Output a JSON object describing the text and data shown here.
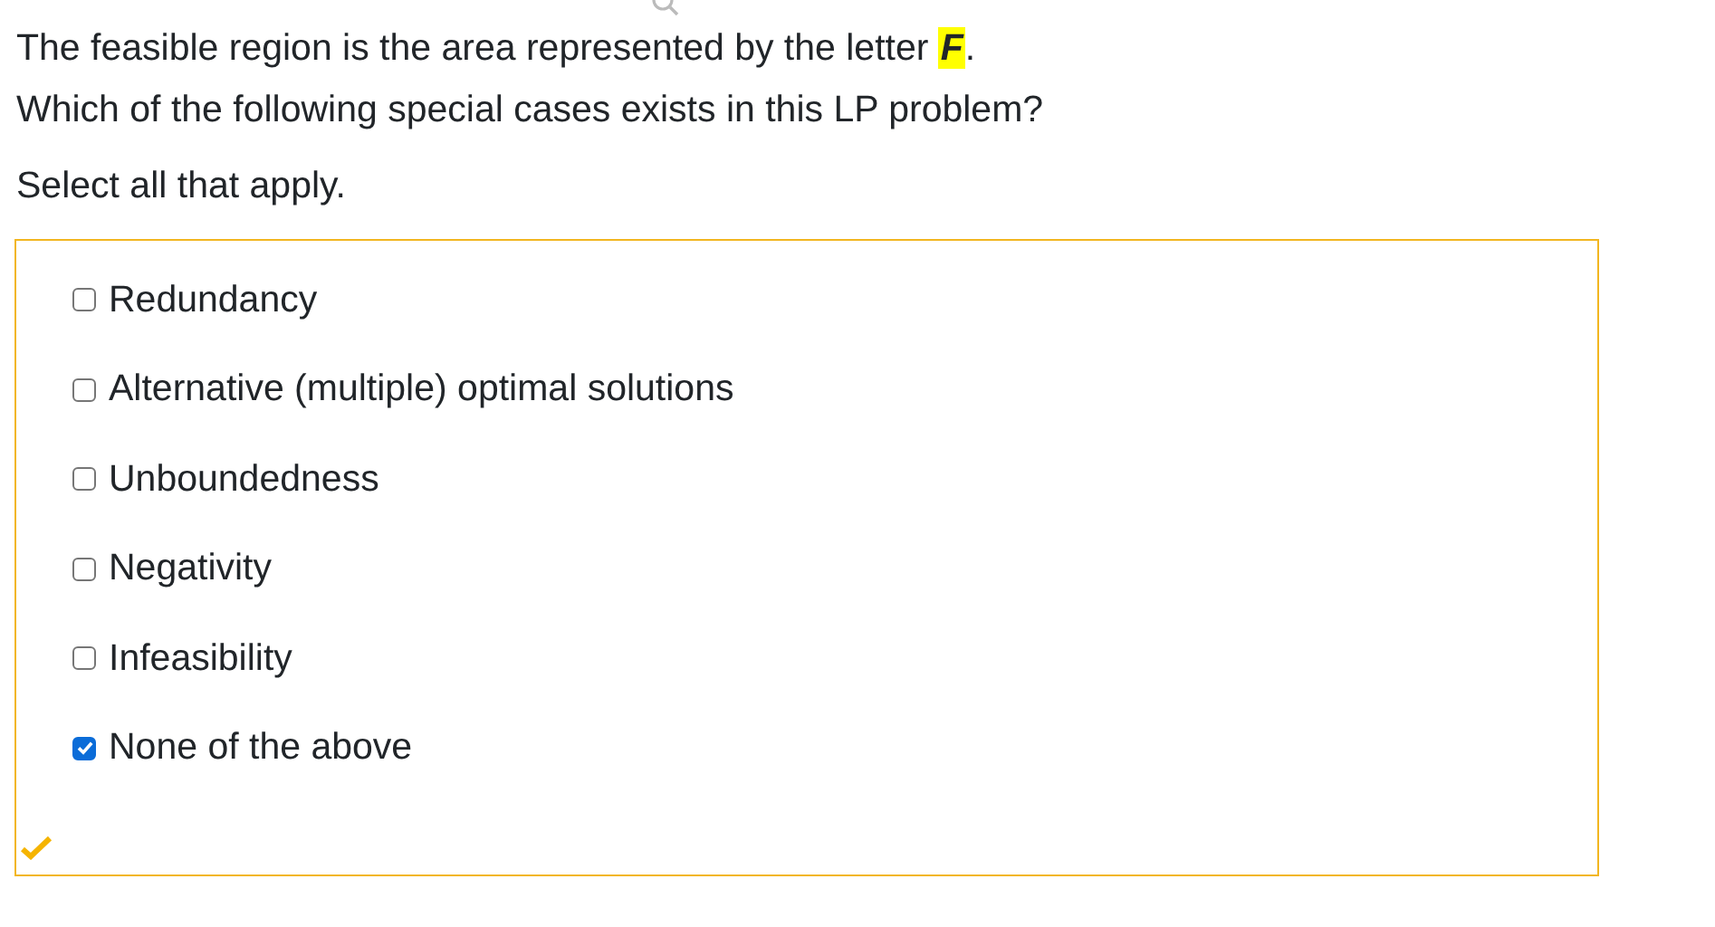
{
  "question": {
    "sentence_start": "The feasible region is the area represented by the letter ",
    "highlighted_letter": "F",
    "sentence_end": ".",
    "prompt": "Which of the following special cases exists in this LP problem?"
  },
  "instruction": "Select all that apply.",
  "options": [
    {
      "label": "Redundancy",
      "checked": false
    },
    {
      "label": "Alternative (multiple) optimal solutions",
      "checked": false
    },
    {
      "label": "Unboundedness",
      "checked": false
    },
    {
      "label": "Negativity",
      "checked": false
    },
    {
      "label": "Infeasibility",
      "checked": false
    },
    {
      "label": "None of the above",
      "checked": true
    }
  ]
}
